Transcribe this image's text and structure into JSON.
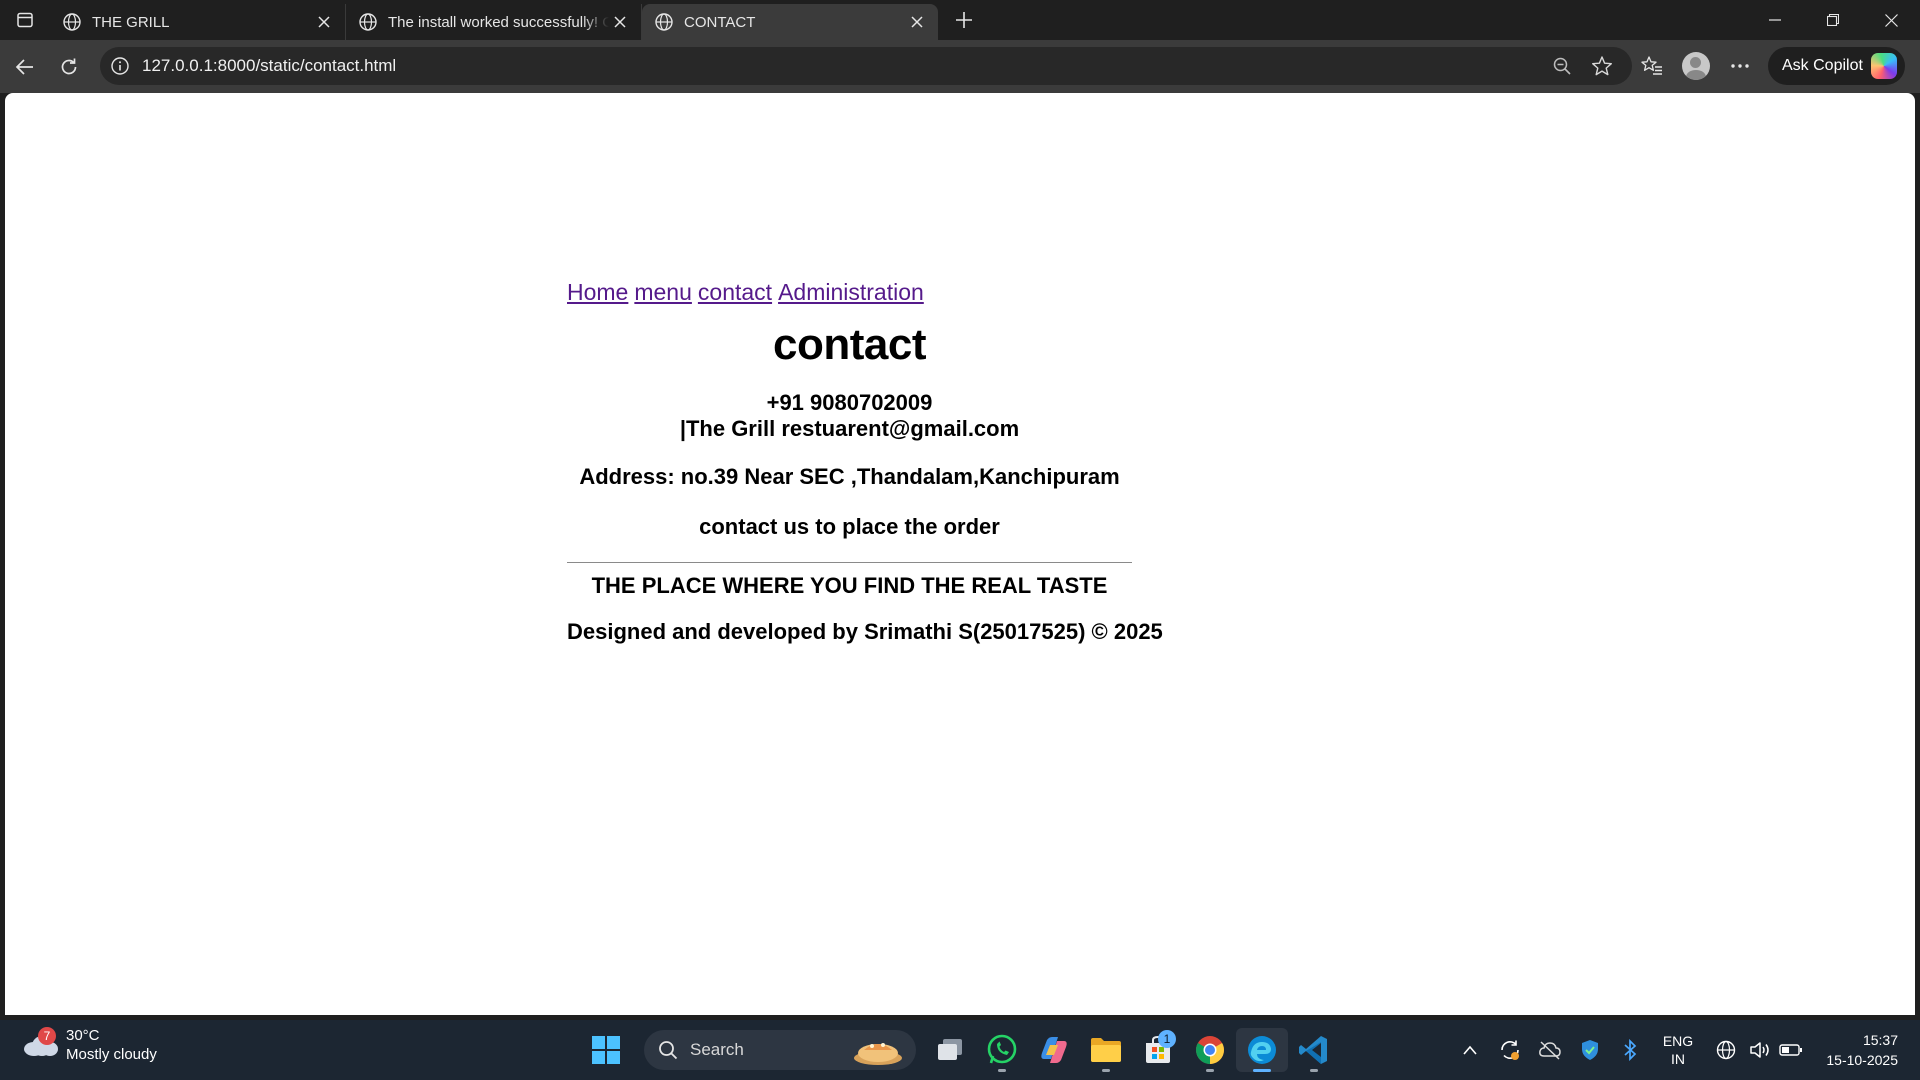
{
  "browser": {
    "tabs": [
      {
        "title": "THE GRILL"
      },
      {
        "title": "The install worked successfully! Congratulations!"
      },
      {
        "title": "CONTACT"
      }
    ],
    "url": "127.0.0.1:8000/static/contact.html",
    "copilot_label": "Ask Copilot"
  },
  "page": {
    "nav": [
      "Home",
      "menu",
      "contact",
      "Administration"
    ],
    "title": "contact",
    "phone": "+91 9080702009",
    "email": "|The Grill restuarent@gmail.com",
    "address": "Address: no.39 Near SEC ,Thandalam,Kanchipuram",
    "order_text": "contact us to place the order",
    "tagline": "THE PLACE WHERE YOU FIND THE REAL TASTE",
    "credits": "Designed and developed by Srimathi S(25017525) © 2025"
  },
  "taskbar": {
    "weather": {
      "temp": "30°C",
      "condition": "Mostly cloudy",
      "badge": "7"
    },
    "search_label": "Search",
    "store_badge": "1",
    "lang_top": "ENG",
    "lang_bottom": "IN",
    "time": "15:37",
    "date": "15-10-2025"
  },
  "colors": {
    "link": "#551a8b",
    "chrome": "#3b3b3b",
    "taskbar": "#1c2632",
    "active_accent": "#5fb2ff"
  }
}
